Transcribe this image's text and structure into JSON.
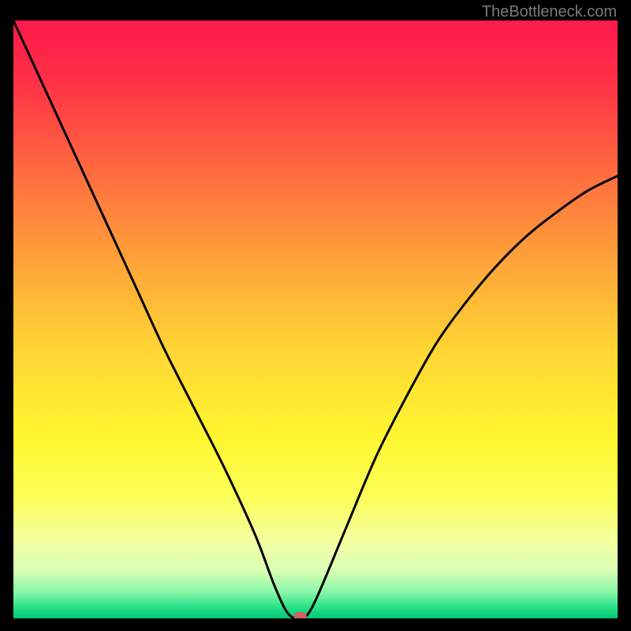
{
  "watermark": "TheBottleneck.com",
  "chart_data": {
    "type": "line",
    "title": "",
    "xlabel": "",
    "ylabel": "",
    "xlim": [
      0,
      100
    ],
    "ylim": [
      0,
      100
    ],
    "background": "rainbow-gradient-vertical",
    "series": [
      {
        "name": "curve",
        "x": [
          0,
          5,
          10,
          15,
          20,
          25,
          30,
          35,
          40,
          43,
          45,
          46.5,
          48,
          50,
          55,
          60,
          65,
          70,
          75,
          80,
          85,
          90,
          95,
          100
        ],
        "values": [
          100,
          89,
          78,
          67,
          56,
          45,
          35,
          25,
          14,
          6,
          1.5,
          0,
          0,
          3,
          15,
          27,
          37,
          46,
          53,
          59,
          64,
          68,
          71.5,
          74
        ]
      }
    ],
    "markers": [
      {
        "name": "dip-marker",
        "x": 47.5,
        "y": 0,
        "color": "#d0605e",
        "shape": "rounded-rect"
      }
    ],
    "gradient_stops": [
      {
        "offset": 0,
        "color": "#ff1a4b"
      },
      {
        "offset": 0.1,
        "color": "#ff3047"
      },
      {
        "offset": 0.25,
        "color": "#ff6a3f"
      },
      {
        "offset": 0.4,
        "color": "#ffa239"
      },
      {
        "offset": 0.55,
        "color": "#ffd534"
      },
      {
        "offset": 0.7,
        "color": "#fff730"
      },
      {
        "offset": 0.8,
        "color": "#fcff5a"
      },
      {
        "offset": 0.87,
        "color": "#f4ffa0"
      },
      {
        "offset": 0.92,
        "color": "#d8ffb5"
      },
      {
        "offset": 0.955,
        "color": "#8cf7a8"
      },
      {
        "offset": 0.98,
        "color": "#2de38a"
      },
      {
        "offset": 1.0,
        "color": "#00c776"
      }
    ]
  }
}
